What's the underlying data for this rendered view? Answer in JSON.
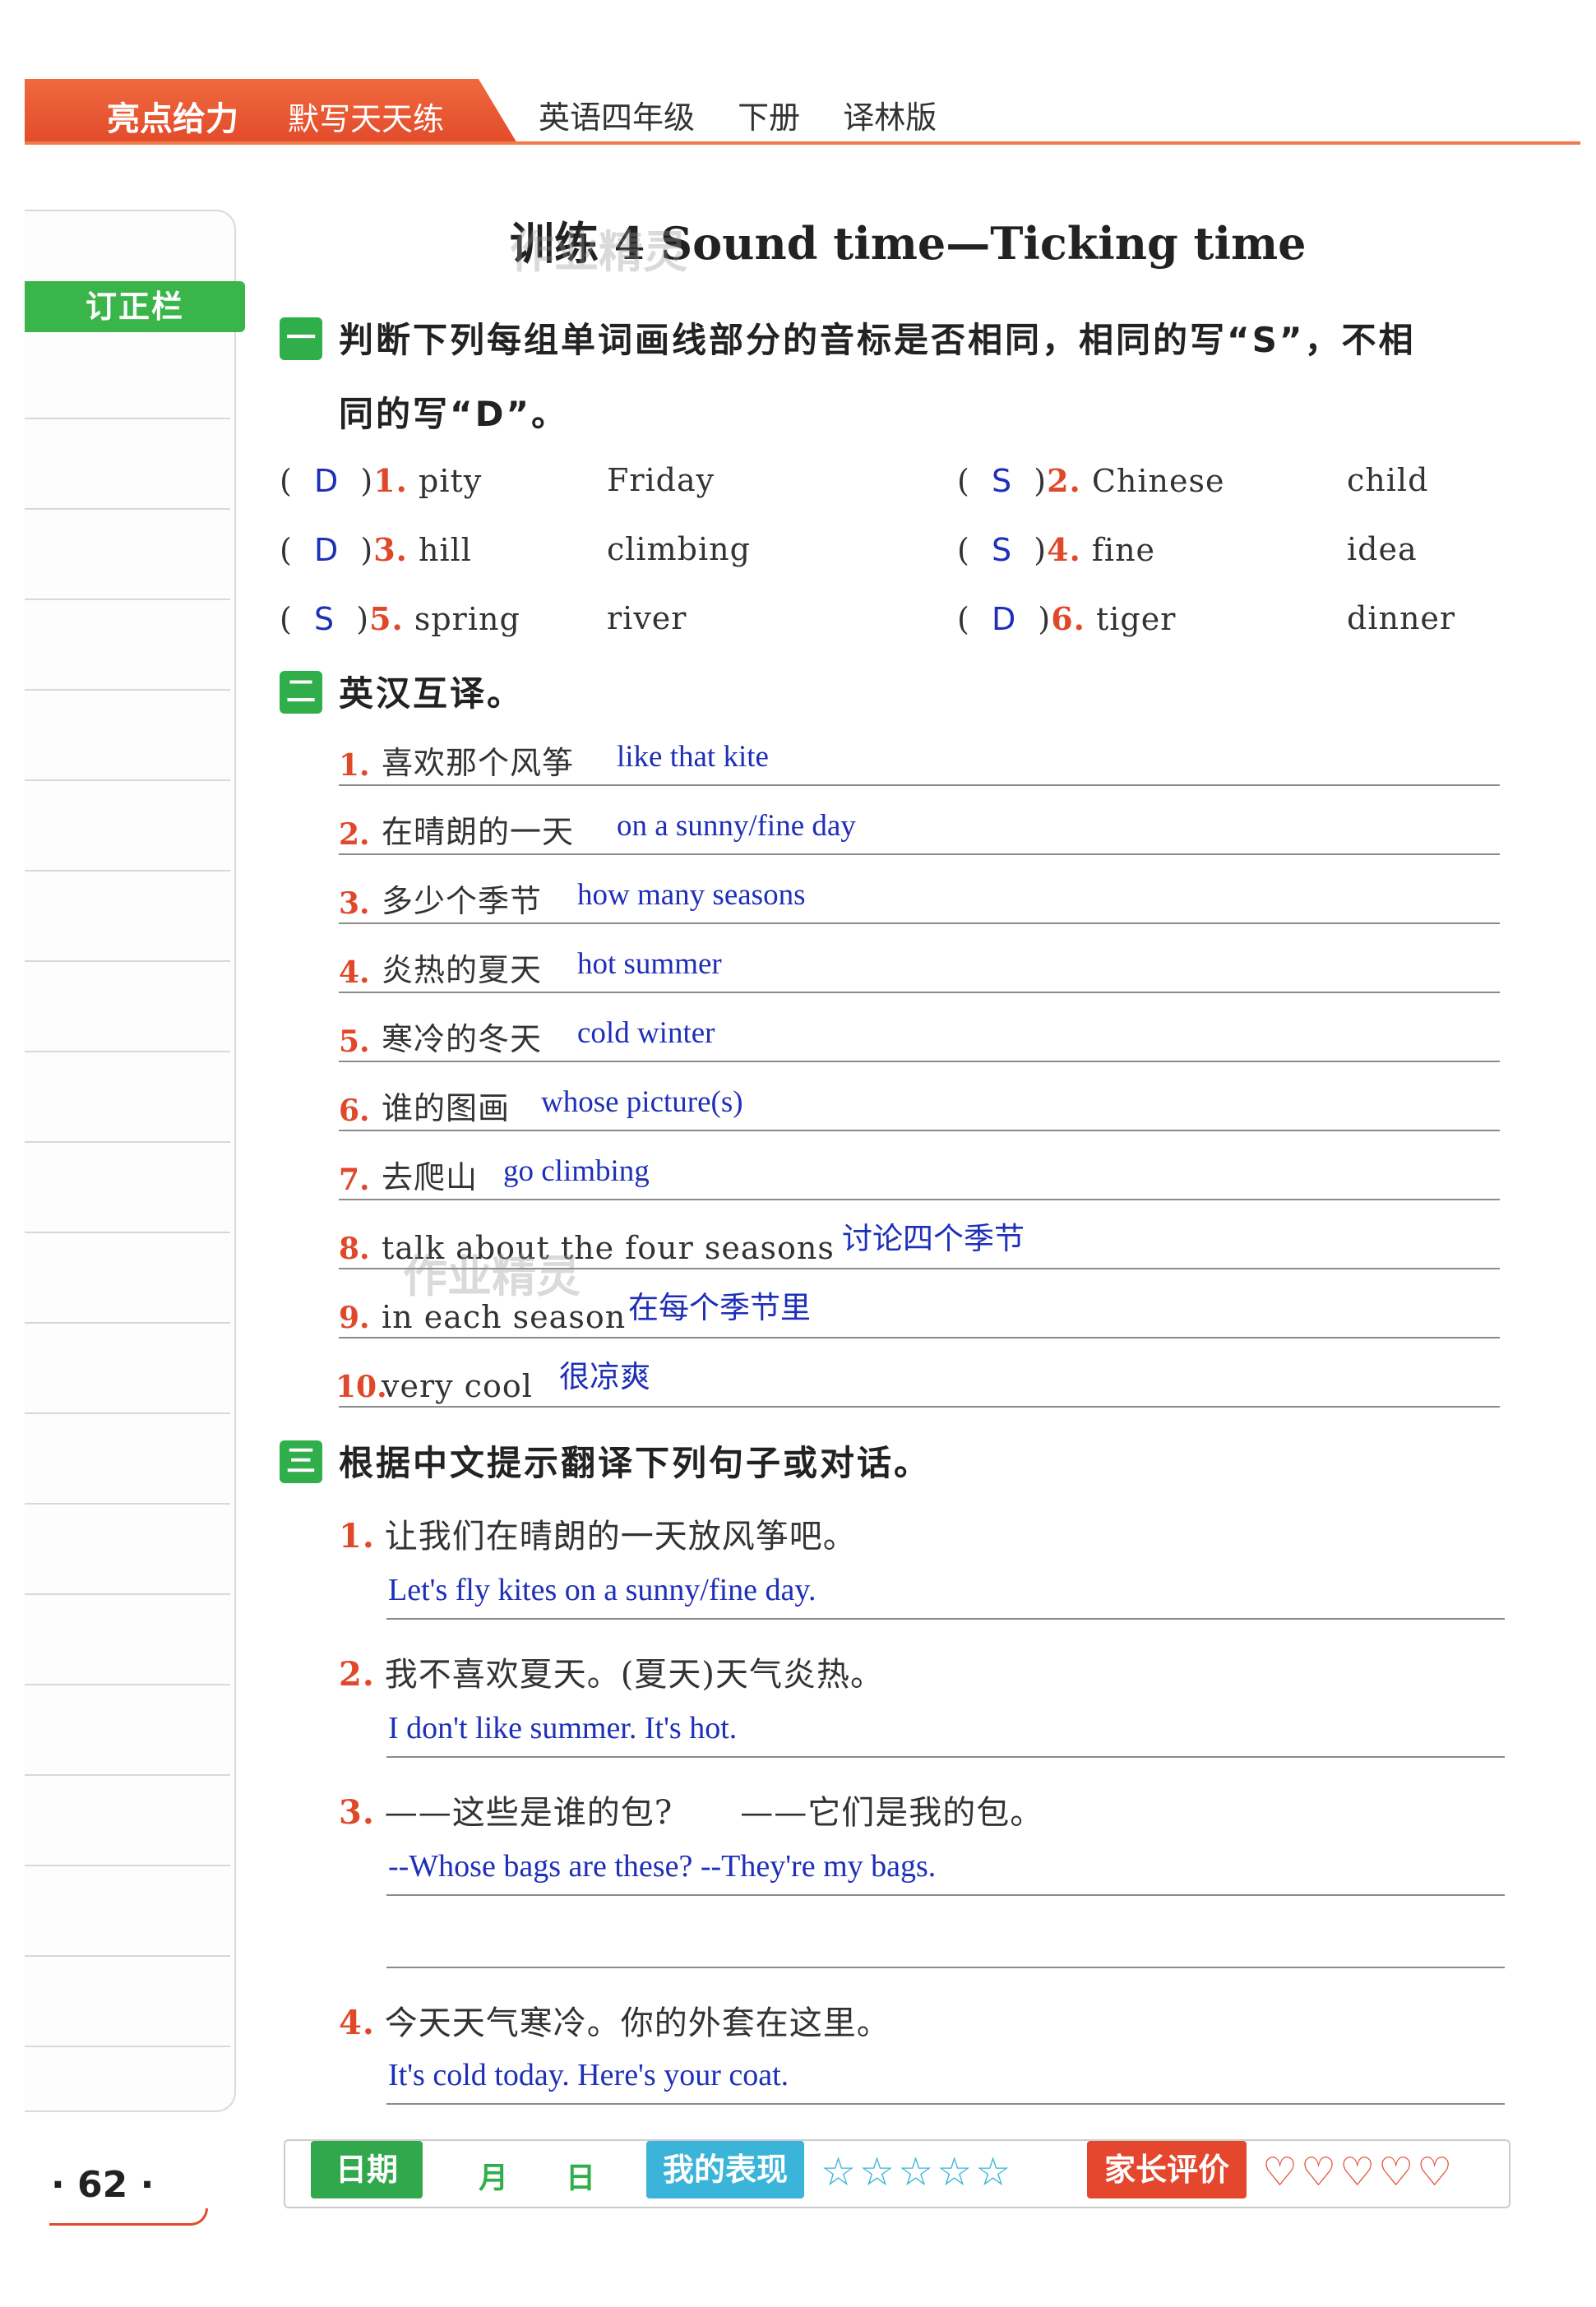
{
  "header": {
    "brand": "亮点给力",
    "series": "默写天天练",
    "subject": "英语四年级",
    "volume": "下册",
    "edition": "译林版"
  },
  "sidebar": {
    "label": "订正栏"
  },
  "title": "训练 4   Sound time—Ticking time",
  "watermark": "作业精灵",
  "section1": {
    "num": "一",
    "instruction_line1": "判断下列每组单词画线部分的音标是否相同，相同的写“S”，不相",
    "instruction_line2": "同的写“D”。",
    "items": [
      {
        "num": "1.",
        "answer": "D",
        "word1": "pity",
        "word2": "Friday"
      },
      {
        "num": "2.",
        "answer": "S",
        "word1": "Chinese",
        "word2": "child"
      },
      {
        "num": "3.",
        "answer": "D",
        "word1": "hill",
        "word2": "climbing"
      },
      {
        "num": "4.",
        "answer": "S",
        "word1": "fine",
        "word2": "idea"
      },
      {
        "num": "5.",
        "answer": "S",
        "word1": "spring",
        "word2": "river"
      },
      {
        "num": "6.",
        "answer": "D",
        "word1": "tiger",
        "word2": "dinner"
      }
    ]
  },
  "section2": {
    "num": "二",
    "instruction": "英汉互译。",
    "items": [
      {
        "num": "1.",
        "q": "喜欢那个风筝",
        "a": "like that kite"
      },
      {
        "num": "2.",
        "q": "在晴朗的一天",
        "a": "on a sunny/fine day"
      },
      {
        "num": "3.",
        "q": "多少个季节",
        "a": "how many seasons"
      },
      {
        "num": "4.",
        "q": "炎热的夏天",
        "a": "hot summer"
      },
      {
        "num": "5.",
        "q": "寒冷的冬天",
        "a": "cold winter"
      },
      {
        "num": "6.",
        "q": "谁的图画",
        "a": "whose picture(s)"
      },
      {
        "num": "7.",
        "q": "去爬山",
        "a": "go climbing"
      },
      {
        "num": "8.",
        "q": "talk about the four seasons",
        "a": "讨论四个季节"
      },
      {
        "num": "9.",
        "q": "in each season",
        "a": "在每个季节里"
      },
      {
        "num": "10.",
        "q": "very cool",
        "a": "很凉爽"
      }
    ]
  },
  "section3": {
    "num": "三",
    "instruction": "根据中文提示翻译下列句子或对话。",
    "items": [
      {
        "num": "1.",
        "q": "让我们在晴朗的一天放风筝吧。",
        "a": "Let's fly kites on a sunny/fine day."
      },
      {
        "num": "2.",
        "q": "我不喜欢夏天。(夏天)天气炎热。",
        "a": "I don't like summer. It's hot."
      },
      {
        "num": "3.",
        "q": "——这些是谁的包?　　——它们是我的包。",
        "a": "--Whose bags are these? --They're my bags."
      },
      {
        "num": "4.",
        "q": "今天天气寒冷。你的外套在这里。",
        "a": "It's cold today. Here's your coat."
      }
    ]
  },
  "footer": {
    "page_number": "· 62 ·",
    "date_label": "日期",
    "month": "月",
    "day": "日",
    "performance_label": "我的表现",
    "performance_stars": "☆☆☆☆☆",
    "parent_label": "家长评价",
    "parent_rating": "♡♡♡♡♡"
  }
}
